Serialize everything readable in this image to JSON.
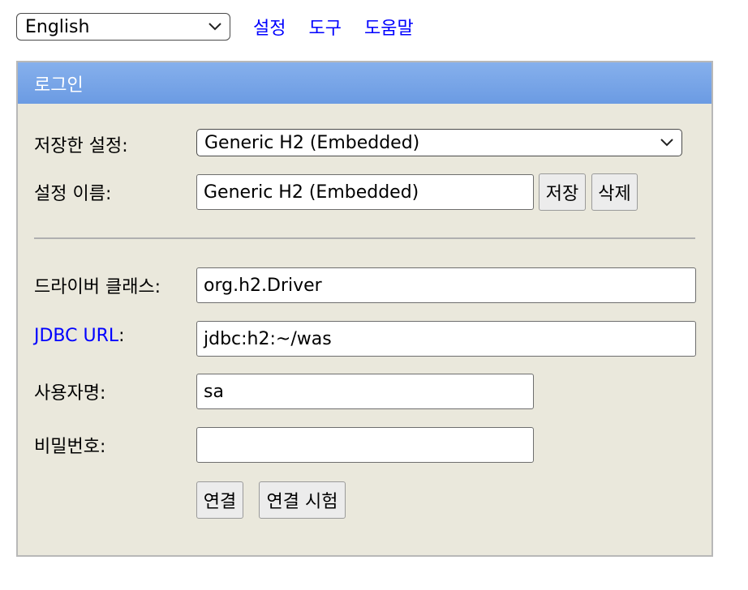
{
  "top": {
    "language": "English",
    "links": [
      "설정",
      "도구",
      "도움말"
    ]
  },
  "panel": {
    "title": "로그인",
    "saved_settings_label": "저장한 설정:",
    "saved_settings_value": "Generic H2 (Embedded)",
    "setting_name_label": "설정 이름:",
    "setting_name_value": "Generic H2 (Embedded)",
    "save_button": "저장",
    "delete_button": "삭제",
    "driver_class_label": "드라이버 클래스:",
    "driver_class_value": "org.h2.Driver",
    "jdbc_url_label": "JDBC URL",
    "jdbc_url_colon": ":",
    "jdbc_url_value": "jdbc:h2:~/was",
    "username_label": "사용자명:",
    "username_value": "sa",
    "password_label": "비밀번호:",
    "password_value": "",
    "connect_button": "연결",
    "test_connection_button": "연결 시험"
  }
}
